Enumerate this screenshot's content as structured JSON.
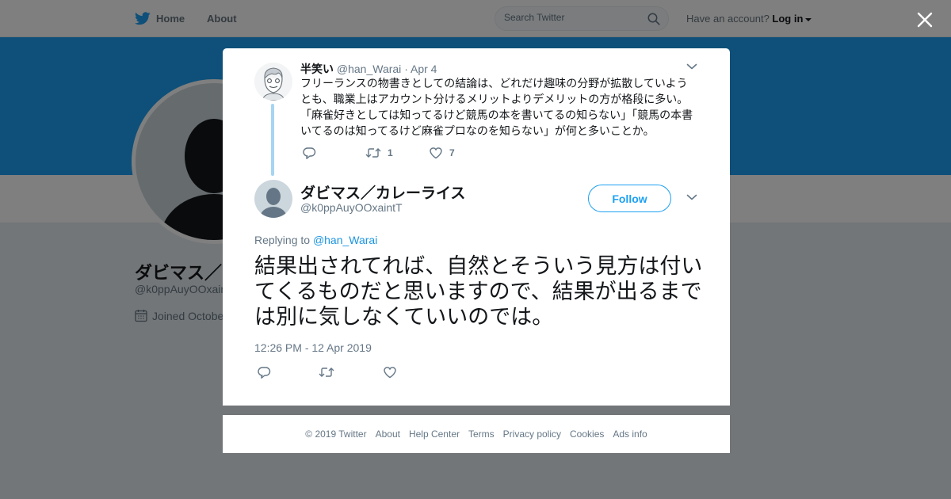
{
  "topbar": {
    "home_label": "Home",
    "about_label": "About",
    "search_placeholder": "Search Twitter",
    "have_account": "Have an account?",
    "login_label": "Log in"
  },
  "profile": {
    "name": "ダビマス／",
    "handle": "@k0ppAuyOOxain",
    "joined": "Joined Octobe"
  },
  "ancestor_tweet": {
    "fullname": "半笑い",
    "handle": "@han_Warai",
    "separator": "·",
    "date": "Apr 4",
    "text": "フリーランスの物書きとしての結論は、どれだけ趣味の分野が拡散していようとも、職業上はアカウント分けるメリットよりデメリットの方が格段に多い。「麻雀好きとしては知ってるけど競馬の本を書いてるの知らない」「競馬の本書いてるのは知ってるけど麻雀プロなのを知らない」が何と多いことか。",
    "retweets": "1",
    "likes": "7"
  },
  "main_tweet": {
    "fullname": "ダビマス／カレーライス",
    "handle": "@k0ppAuyOOxaintT",
    "follow_label": "Follow",
    "replying_prefix": "Replying to",
    "replying_to": "@han_Warai",
    "text": "結果出されてれば、自然とそういう見方は付いてくるものだと思いますので、結果が出るまでは別に気しなくていいのでは。",
    "timestamp": "12:26 PM - 12 Apr 2019"
  },
  "footer": {
    "links": [
      "© 2019 Twitter",
      "About",
      "Help Center",
      "Terms",
      "Privacy policy",
      "Cookies",
      "Ads info"
    ]
  },
  "colors": {
    "accent": "#1da1f2",
    "link": "#1b95e0",
    "muted": "#657786",
    "thread_line": "#a6d4f2"
  }
}
